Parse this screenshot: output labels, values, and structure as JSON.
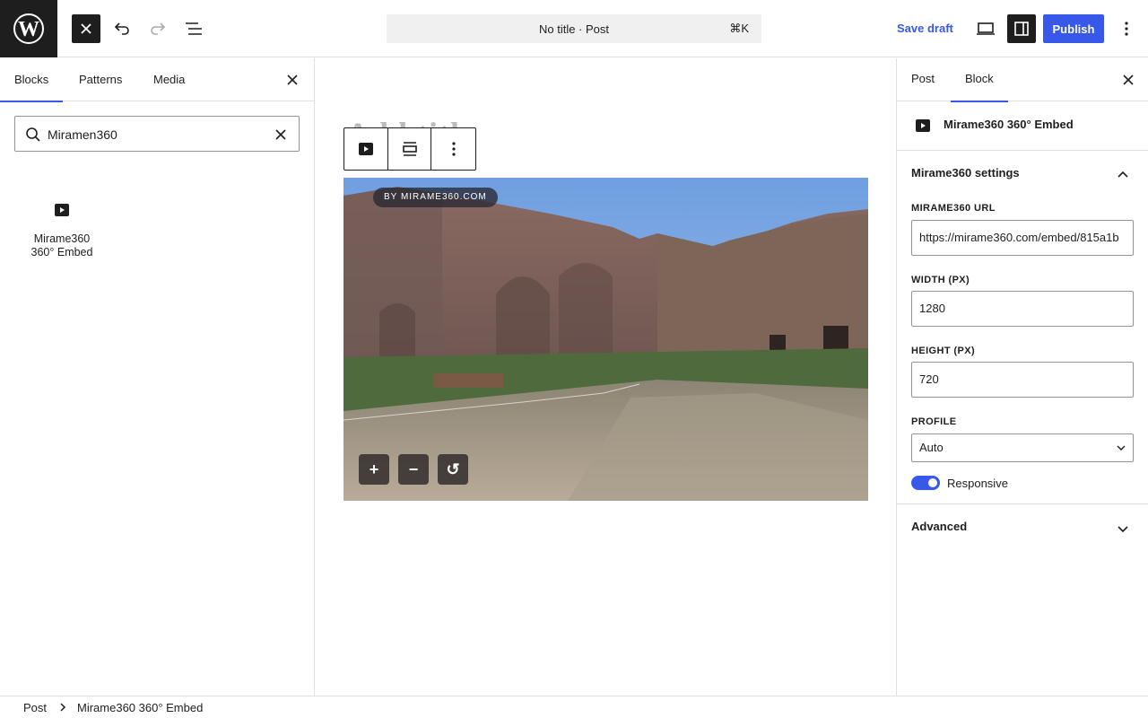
{
  "topbar": {
    "doc_title": "No title · Post",
    "shortcut": "⌘K",
    "save_draft": "Save draft",
    "publish": "Publish"
  },
  "inserter": {
    "tabs": [
      "Blocks",
      "Patterns",
      "Media"
    ],
    "active_tab": "Blocks",
    "search_value": "Miramen360",
    "results": [
      {
        "label_line1": "Mirame360",
        "label_line2": "360° Embed",
        "icon": "video-play-icon"
      }
    ]
  },
  "canvas": {
    "title_placeholder": "Add title",
    "embed_badge": "BY MIRAME360.COM",
    "controls": [
      "+",
      "−",
      "↺"
    ]
  },
  "sidebar": {
    "tabs": [
      "Post",
      "Block"
    ],
    "active_tab": "Block",
    "block_name": "Mirame360 360° Embed",
    "settings_title": "Mirame360 settings",
    "url_label": "MIRAME360 URL",
    "url_value": "https://mirame360.com/embed/815a1b",
    "width_label": "WIDTH (PX)",
    "width_value": "1280",
    "height_label": "HEIGHT (PX)",
    "height_value": "720",
    "profile_label": "PROFILE",
    "profile_value": "Auto",
    "responsive_label": "Responsive",
    "responsive_on": true,
    "advanced_title": "Advanced"
  },
  "breadcrumb": {
    "items": [
      "Post",
      "Mirame360 360° Embed"
    ]
  },
  "colors": {
    "accent": "#3858e9",
    "dark": "#1e1e1e"
  }
}
